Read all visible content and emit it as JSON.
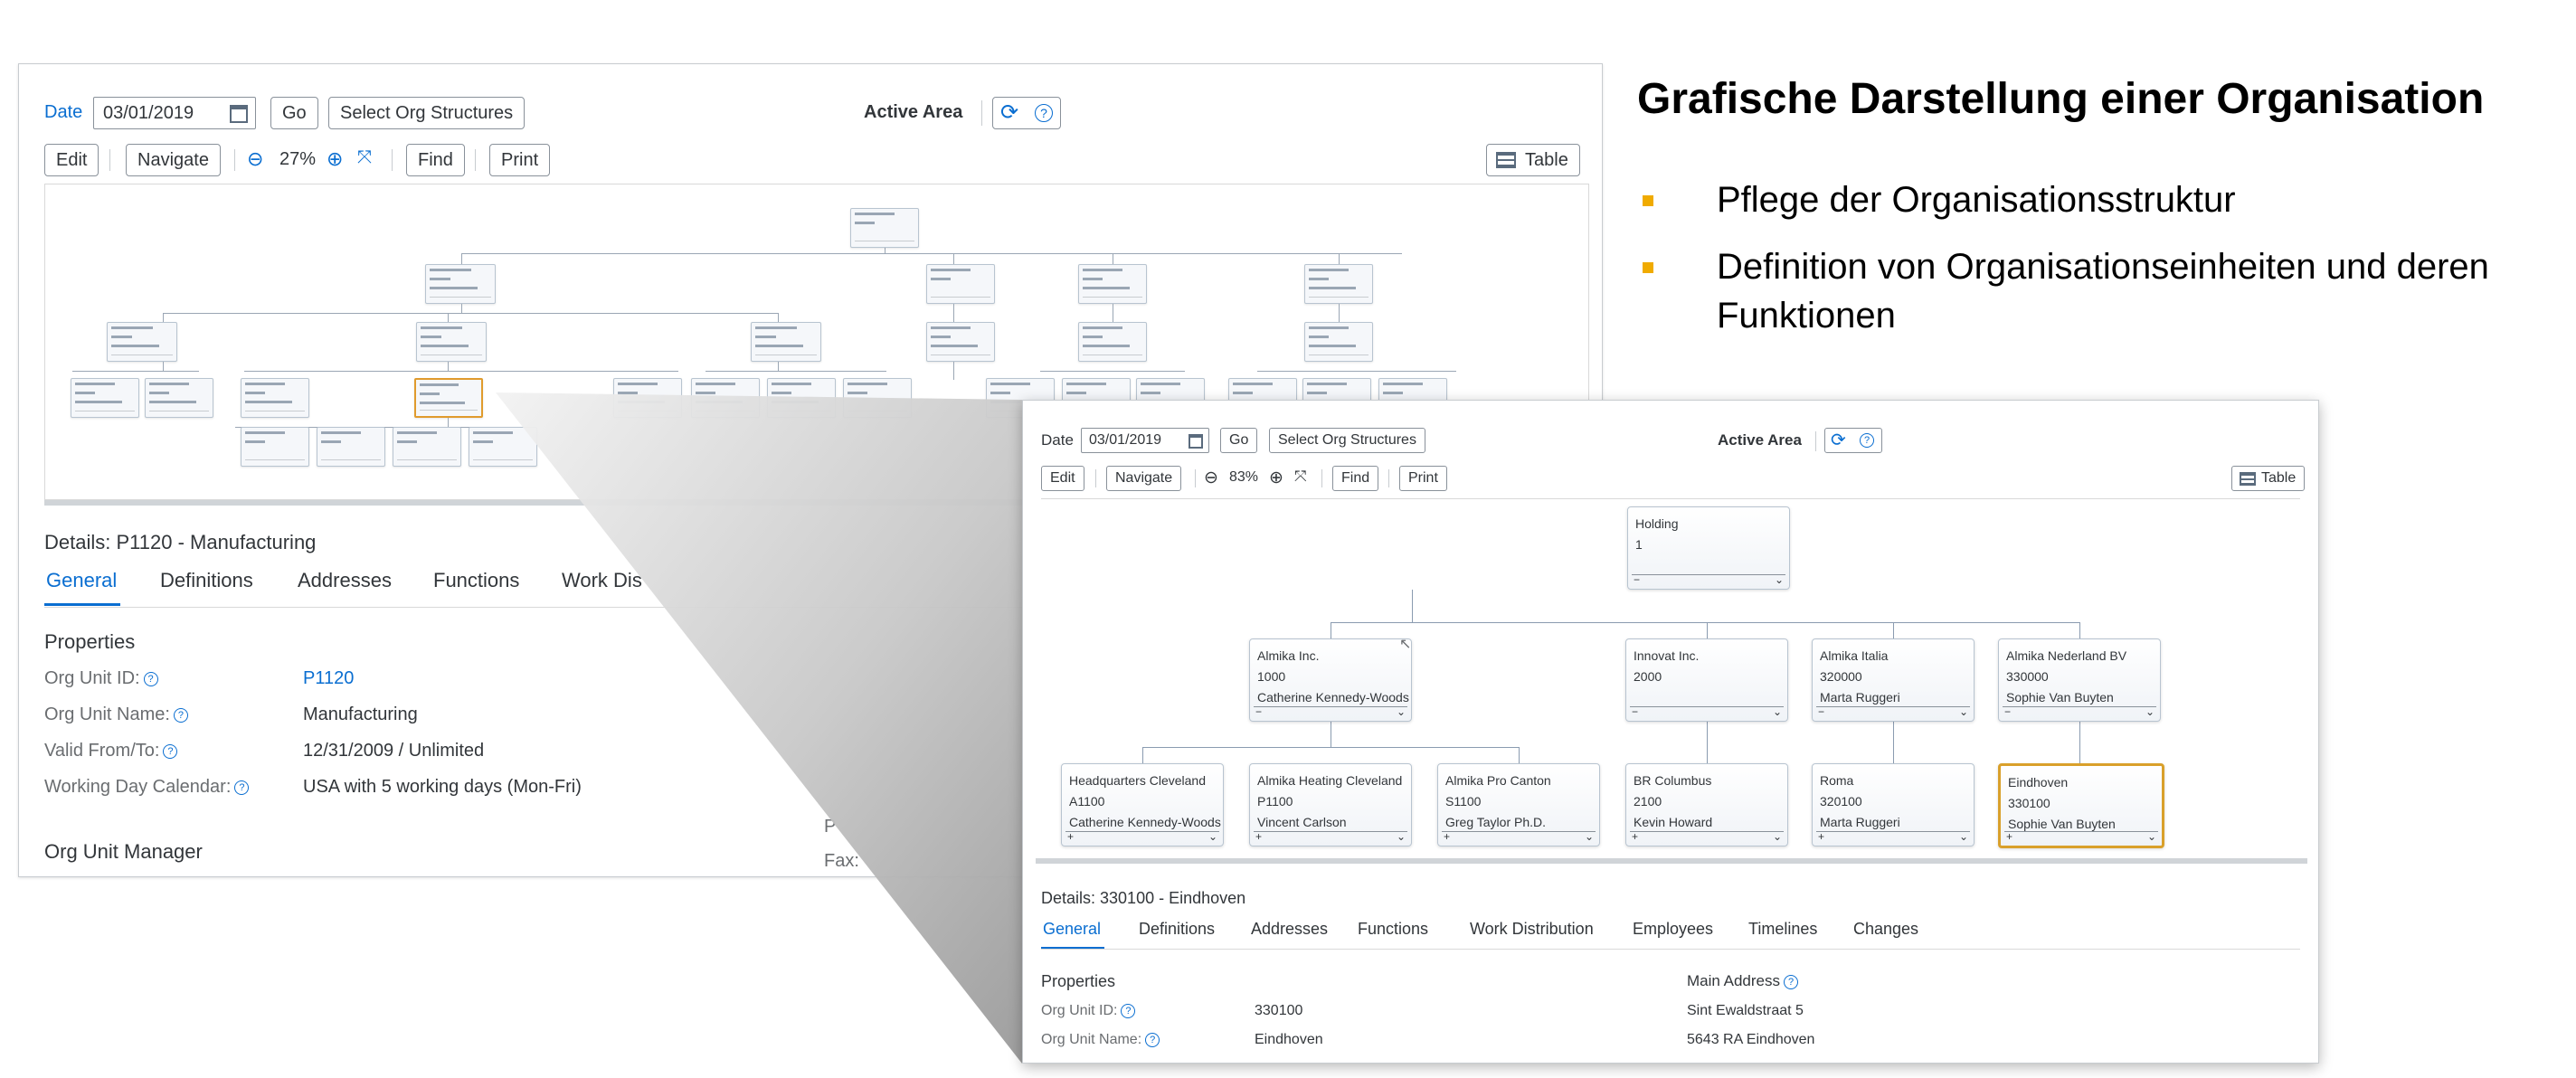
{
  "slide": {
    "title": "Grafische Darstellung einer Organisation",
    "bullets": [
      "Pflege der Organisationsstruktur",
      "Definition von Organisationseinheiten und deren",
      "Funktionen"
    ]
  },
  "back_window": {
    "date_label": "Date",
    "date_value": "03/01/2019",
    "go": "Go",
    "select_org": "Select Org Structures",
    "active_area": "Active Area",
    "edit": "Edit",
    "navigate": "Navigate",
    "zoom": "27%",
    "find": "Find",
    "print": "Print",
    "table": "Table",
    "details_title": "Details: P1120 - Manufacturing",
    "tabs": [
      "General",
      "Definitions",
      "Addresses",
      "Functions",
      "Work Dis"
    ],
    "properties_title": "Properties",
    "props": [
      {
        "label": "Org Unit ID:",
        "value": "P1120"
      },
      {
        "label": "Org Unit Name:",
        "value": "Manufacturing"
      },
      {
        "label": "Valid From/To:",
        "value": "12/31/2009 / Unlimited"
      },
      {
        "label": "Working Day Calendar:",
        "value": "USA with 5 working days (Mon-Fri)"
      }
    ],
    "manager_title": "Org Unit Manager",
    "partial_p": "P",
    "partial_fax": "Fax:"
  },
  "front_window": {
    "date_label": "Date",
    "date_value": "03/01/2019",
    "go": "Go",
    "select_org": "Select Org Structures",
    "active_area": "Active Area",
    "edit": "Edit",
    "navigate": "Navigate",
    "zoom": "83%",
    "find": "Find",
    "print": "Print",
    "table": "Table",
    "nodes": {
      "holding": {
        "name": "Holding",
        "id": "1",
        "person": ""
      },
      "almika_inc": {
        "name": "Almika Inc.",
        "id": "1000",
        "person": "Catherine Kennedy-Woods"
      },
      "innovat": {
        "name": "Innovat Inc.",
        "id": "2000",
        "person": ""
      },
      "italia": {
        "name": "Almika Italia",
        "id": "320000",
        "person": "Marta Ruggeri"
      },
      "nederland": {
        "name": "Almika Nederland BV",
        "id": "330000",
        "person": "Sophie Van Buyten"
      },
      "hq": {
        "name": "Headquarters Cleveland",
        "id": "A1100",
        "person": "Catherine Kennedy-Woods"
      },
      "heating": {
        "name": "Almika Heating Cleveland",
        "id": "P1100",
        "person": "Vincent Carlson"
      },
      "canton": {
        "name": "Almika Pro Canton",
        "id": "S1100",
        "person": "Greg Taylor Ph.D."
      },
      "columbus": {
        "name": "BR Columbus",
        "id": "2100",
        "person": "Kevin Howard"
      },
      "roma": {
        "name": "Roma",
        "id": "320100",
        "person": "Marta Ruggeri"
      },
      "eindhoven": {
        "name": "Eindhoven",
        "id": "330100",
        "person": "Sophie Van Buyten"
      }
    },
    "details_title": "Details: 330100 - Eindhoven",
    "tabs": [
      "General",
      "Definitions",
      "Addresses",
      "Functions",
      "Work Distribution",
      "Employees",
      "Timelines",
      "Changes"
    ],
    "properties_title": "Properties",
    "props": [
      {
        "label": "Org Unit ID:",
        "value": "330100"
      },
      {
        "label": "Org Unit Name:",
        "value": "Eindhoven"
      }
    ],
    "main_address_title": "Main Address",
    "address_lines": [
      "Sint Ewaldstraat 5",
      "5643 RA  Eindhoven"
    ]
  },
  "colors": {
    "accent": "#0a6ed1",
    "bullet": "#f0ab00",
    "selected_node": "#d9a02b"
  }
}
